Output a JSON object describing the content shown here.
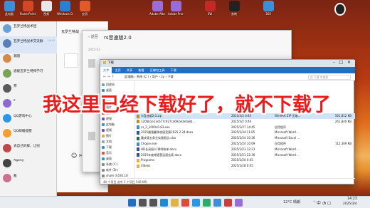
{
  "desktop_icons": [
    {
      "label": "此电脑",
      "color": "#3b8fd9"
    },
    {
      "label": "PowerPoint",
      "color": "#d24726"
    },
    {
      "label": "视频",
      "color": "#e8e8e8"
    },
    {
      "label": "Windows Defender",
      "color": "#2a7fd4"
    },
    {
      "label": "应用",
      "color": "#e05b2a"
    },
    {
      "label": "Adobe After Effects",
      "color": "#9b6bd9"
    },
    {
      "label": "Adobe Premiere",
      "color": "#9b6bd9"
    },
    {
      "label": "SW",
      "color": "#c62828"
    },
    {
      "label": "剪映",
      "color": "#222222"
    },
    {
      "label": "360",
      "color": "#3b8fd9"
    }
  ],
  "qq": {
    "contacts": [
      {
        "name": "瓦罗兰特战术团",
        "msg": "",
        "time": "",
        "color": "#6aa0d8"
      },
      {
        "name": "瓦罗兰特战术交流群",
        "msg": "",
        "time": "14:42",
        "color": "#5a7db5"
      },
      {
        "name": "瀚丽",
        "msg": "",
        "time": "",
        "color": "#d58a4a"
      },
      {
        "name": "通能瓦罗兰特探学习",
        "msg": "",
        "time": "",
        "color": "#7aa35a"
      },
      {
        "name": "邦",
        "msg": "",
        "time": "",
        "color": "#5a5a5a"
      },
      {
        "name": "z",
        "msg": "",
        "time": "",
        "color": "#8a6bd0"
      },
      {
        "name": "QQ游戏中心",
        "msg": "",
        "time": "",
        "color": "#2a96e8"
      },
      {
        "name": "QQ邮箱提醒",
        "msg": "",
        "time": "",
        "color": "#f0a030"
      },
      {
        "name": "去自己的群，让别",
        "msg": "",
        "time": "",
        "color": "#c04848"
      },
      {
        "name": "Agony",
        "msg": "",
        "time": "",
        "color": "#444444"
      },
      {
        "name": "雅",
        "msg": "",
        "time": "",
        "color": "#d07090"
      }
    ]
  },
  "chat": {
    "title": "瓦罗兰特战"
  },
  "downloads": {
    "title": "rs音速版2.0",
    "date": "2025-03"
  },
  "explorer": {
    "tab_title": "下载",
    "menu": [
      "文件",
      "主页",
      "共享",
      "查看",
      "压缩包工具",
      "下载"
    ],
    "path": [
      "此电脑",
      "系统 (C:)",
      "用户",
      "zy",
      "下载"
    ],
    "search_placeholder": "在 下载 中搜索",
    "nav": [
      {
        "label": "回收站",
        "color": "#7a9cc6"
      },
      {
        "label": "桌面",
        "color": "#3b8fd9"
      },
      {
        "label": "下载",
        "color": "#3b8fd9"
      },
      {
        "label": "文档",
        "color": "#9aa6b2"
      },
      {
        "label": "图片",
        "color": "#e3a93a"
      },
      {
        "label": "音乐",
        "color": "#e0533d"
      },
      {
        "label": "视频",
        "color": "#6b53c9"
      },
      {
        "label": "此电脑",
        "color": "#3b8fd9"
      },
      {
        "label": "视频",
        "color": "#6b53c9"
      },
      {
        "label": "图片",
        "color": "#e3a93a"
      },
      {
        "label": "文档",
        "color": "#9aa6b2"
      },
      {
        "label": "下载",
        "color": "#3b8fd9"
      },
      {
        "label": "音乐",
        "color": "#e0533d"
      },
      {
        "label": "桌面",
        "color": "#3b8fd9"
      },
      {
        "label": "系统 (C:)",
        "color": "#888888"
      },
      {
        "label": "软件 (D:)",
        "color": "#888888"
      },
      {
        "label": "share (\\\\192.16",
        "color": "#888888"
      }
    ],
    "rows": [
      {
        "name": "rs音速版2.0.zip",
        "date": "2025/3/2 0:43",
        "type": "WinRAR ZIP 压缩...",
        "size": "561,812 KB",
        "color": "#c98a2a",
        "sel": true
      },
      {
        "name": "1206b1e13c677c927ca692e0e0a8b...",
        "date": "2025/3/2 0:40",
        "type": "",
        "size": "261,840 KB",
        "color": "#c98a2a",
        "sel": false
      },
      {
        "name": "cs_2_1000v0.83.exe",
        "date": "2025/2/27 14:45",
        "type": "应用程序",
        "size": "",
        "color": "#3b8fd9",
        "sel": false
      },
      {
        "name": "2025最强暑季校园竞赛2025.2.24.docx",
        "date": "2025/2/24 11:05",
        "type": "Microsoft Word ...",
        "size": "",
        "color": "#2b5797",
        "sel": false
      },
      {
        "name": "重庆版五条业实践报告.xlsx",
        "date": "2025/2/24 10:36",
        "type": "Microsoft Excel ...",
        "size": "",
        "color": "#217346",
        "sel": false
      },
      {
        "name": "Chopie.exe",
        "date": "2025/2/24 10:09",
        "type": "应用程序",
        "size": "112,309 KB",
        "color": "#3b8fd9",
        "sel": false
      },
      {
        "name": "HD长高振兴 律师帐单.docx",
        "date": "2025/2/23 12:23",
        "type": "Microsoft Word ...",
        "size": "",
        "color": "#2b5797",
        "sel": false
      },
      {
        "name": "2025年度增速营运报告表.docx",
        "date": "2025/2/21 22:36",
        "type": "Microsoft Word ...",
        "size": "",
        "color": "#2b5797",
        "sel": false
      },
      {
        "name": "Programs",
        "date": "2025/2/20 0:45",
        "type": "",
        "size": "",
        "color": "#e3b341",
        "sel": false
      },
      {
        "name": "Videos",
        "date": "2025/2/28 0:05",
        "type": "",
        "size": "",
        "color": "#e3b341",
        "sel": false
      }
    ],
    "status": "40 个项目    选中 1 个项目  548 MB"
  },
  "caption": "我这里已经下载好了，就不下载了",
  "taskbar": {
    "icons": [
      {
        "name": "windows",
        "color": "#1f6fc4"
      },
      {
        "name": "search",
        "color": "#555555"
      },
      {
        "name": "task-view",
        "color": "#555555"
      },
      {
        "name": "edge",
        "color": "#1b8bd6"
      },
      {
        "name": "explorer",
        "color": "#e3b341"
      },
      {
        "name": "chrome",
        "color": "#dd4b39"
      },
      {
        "name": "qq",
        "color": "#2a96e8"
      },
      {
        "name": "wechat",
        "color": "#2aae67"
      },
      {
        "name": "store",
        "color": "#3b8fd9"
      },
      {
        "name": "music",
        "color": "#d03a3a"
      },
      {
        "name": "app",
        "color": "#9b6bd9"
      }
    ],
    "weather": "12°C 晴朗",
    "time": "14:23",
    "date": "2025/3/4"
  }
}
